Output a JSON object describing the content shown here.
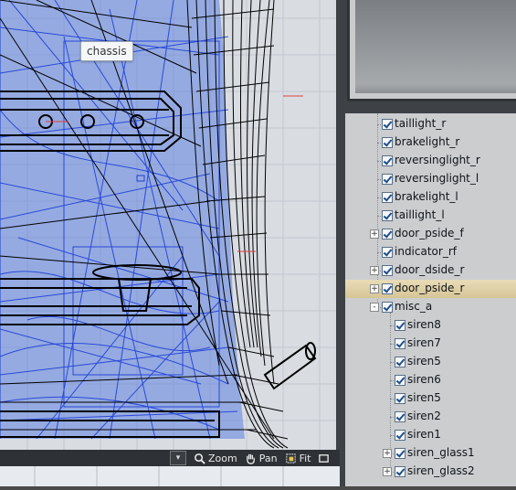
{
  "tooltip": {
    "text": "chassis"
  },
  "toolbar": {
    "zoom": "Zoom",
    "pan": "Pan",
    "fit": "Fit"
  },
  "outliner": {
    "items": [
      {
        "label": "taillight_r",
        "level": 1,
        "expander": "",
        "selected": false
      },
      {
        "label": "brakelight_r",
        "level": 1,
        "expander": "",
        "selected": false
      },
      {
        "label": "reversinglight_r",
        "level": 1,
        "expander": "",
        "selected": false
      },
      {
        "label": "reversinglight_l",
        "level": 1,
        "expander": "",
        "selected": false
      },
      {
        "label": "brakelight_l",
        "level": 1,
        "expander": "",
        "selected": false
      },
      {
        "label": "taillight_l",
        "level": 1,
        "expander": "",
        "selected": false
      },
      {
        "label": "door_pside_f",
        "level": 1,
        "expander": "+",
        "selected": false
      },
      {
        "label": "indicator_rf",
        "level": 1,
        "expander": "",
        "selected": false
      },
      {
        "label": "door_dside_r",
        "level": 1,
        "expander": "+",
        "selected": false
      },
      {
        "label": "door_pside_r",
        "level": 1,
        "expander": "+",
        "selected": true
      },
      {
        "label": "misc_a",
        "level": 1,
        "expander": "-",
        "selected": false
      },
      {
        "label": "siren8",
        "level": 2,
        "expander": "",
        "selected": false
      },
      {
        "label": "siren7",
        "level": 2,
        "expander": "",
        "selected": false
      },
      {
        "label": "siren5",
        "level": 2,
        "expander": "",
        "selected": false
      },
      {
        "label": "siren6",
        "level": 2,
        "expander": "",
        "selected": false
      },
      {
        "label": "siren5",
        "level": 2,
        "expander": "",
        "selected": false
      },
      {
        "label": "siren2",
        "level": 2,
        "expander": "",
        "selected": false
      },
      {
        "label": "siren1",
        "level": 2,
        "expander": "",
        "selected": false
      },
      {
        "label": "siren_glass1",
        "level": 2,
        "expander": "+",
        "selected": false
      },
      {
        "label": "siren_glass2",
        "level": 2,
        "expander": "+",
        "selected": false
      }
    ]
  }
}
